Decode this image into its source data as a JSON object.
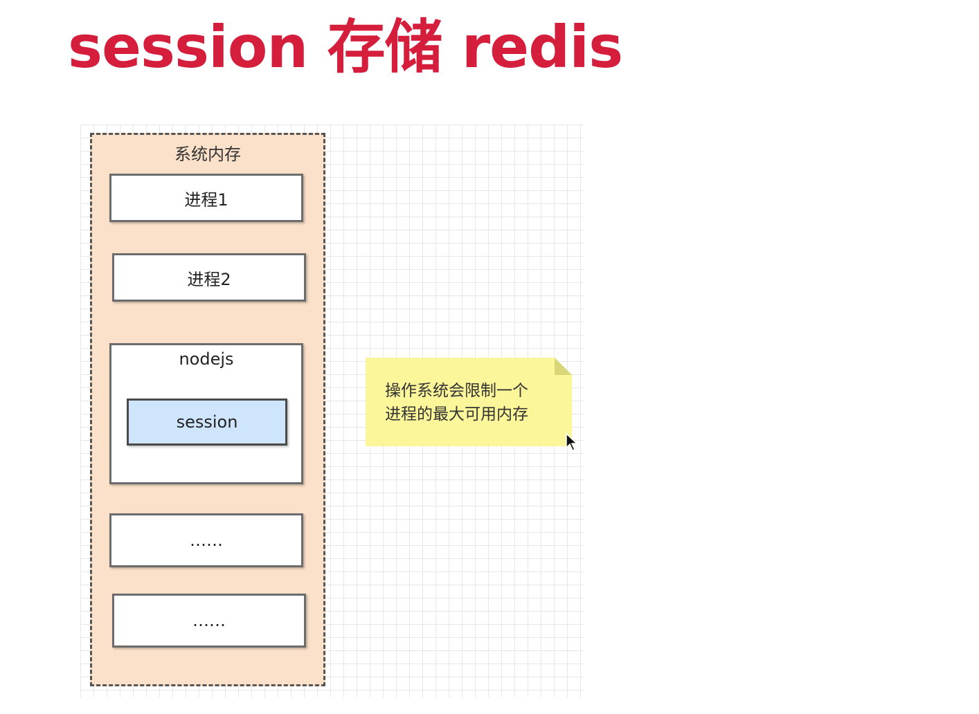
{
  "title": "session 存储 redis",
  "diagram": {
    "memory_label": "系统内存",
    "processes": [
      "进程1",
      "进程2",
      "……",
      "……"
    ],
    "nodejs_label": "nodejs",
    "session_label": "session",
    "note_lines": [
      "操作系统会限制一个",
      "进程的最大可用内存"
    ]
  },
  "colors": {
    "title": "#d41e3c",
    "memory_fill": "#fbe1c9",
    "session_fill": "#cfe5fb",
    "note_fill": "#fbf69a"
  },
  "icons": [
    "mouse-pointer-icon"
  ]
}
